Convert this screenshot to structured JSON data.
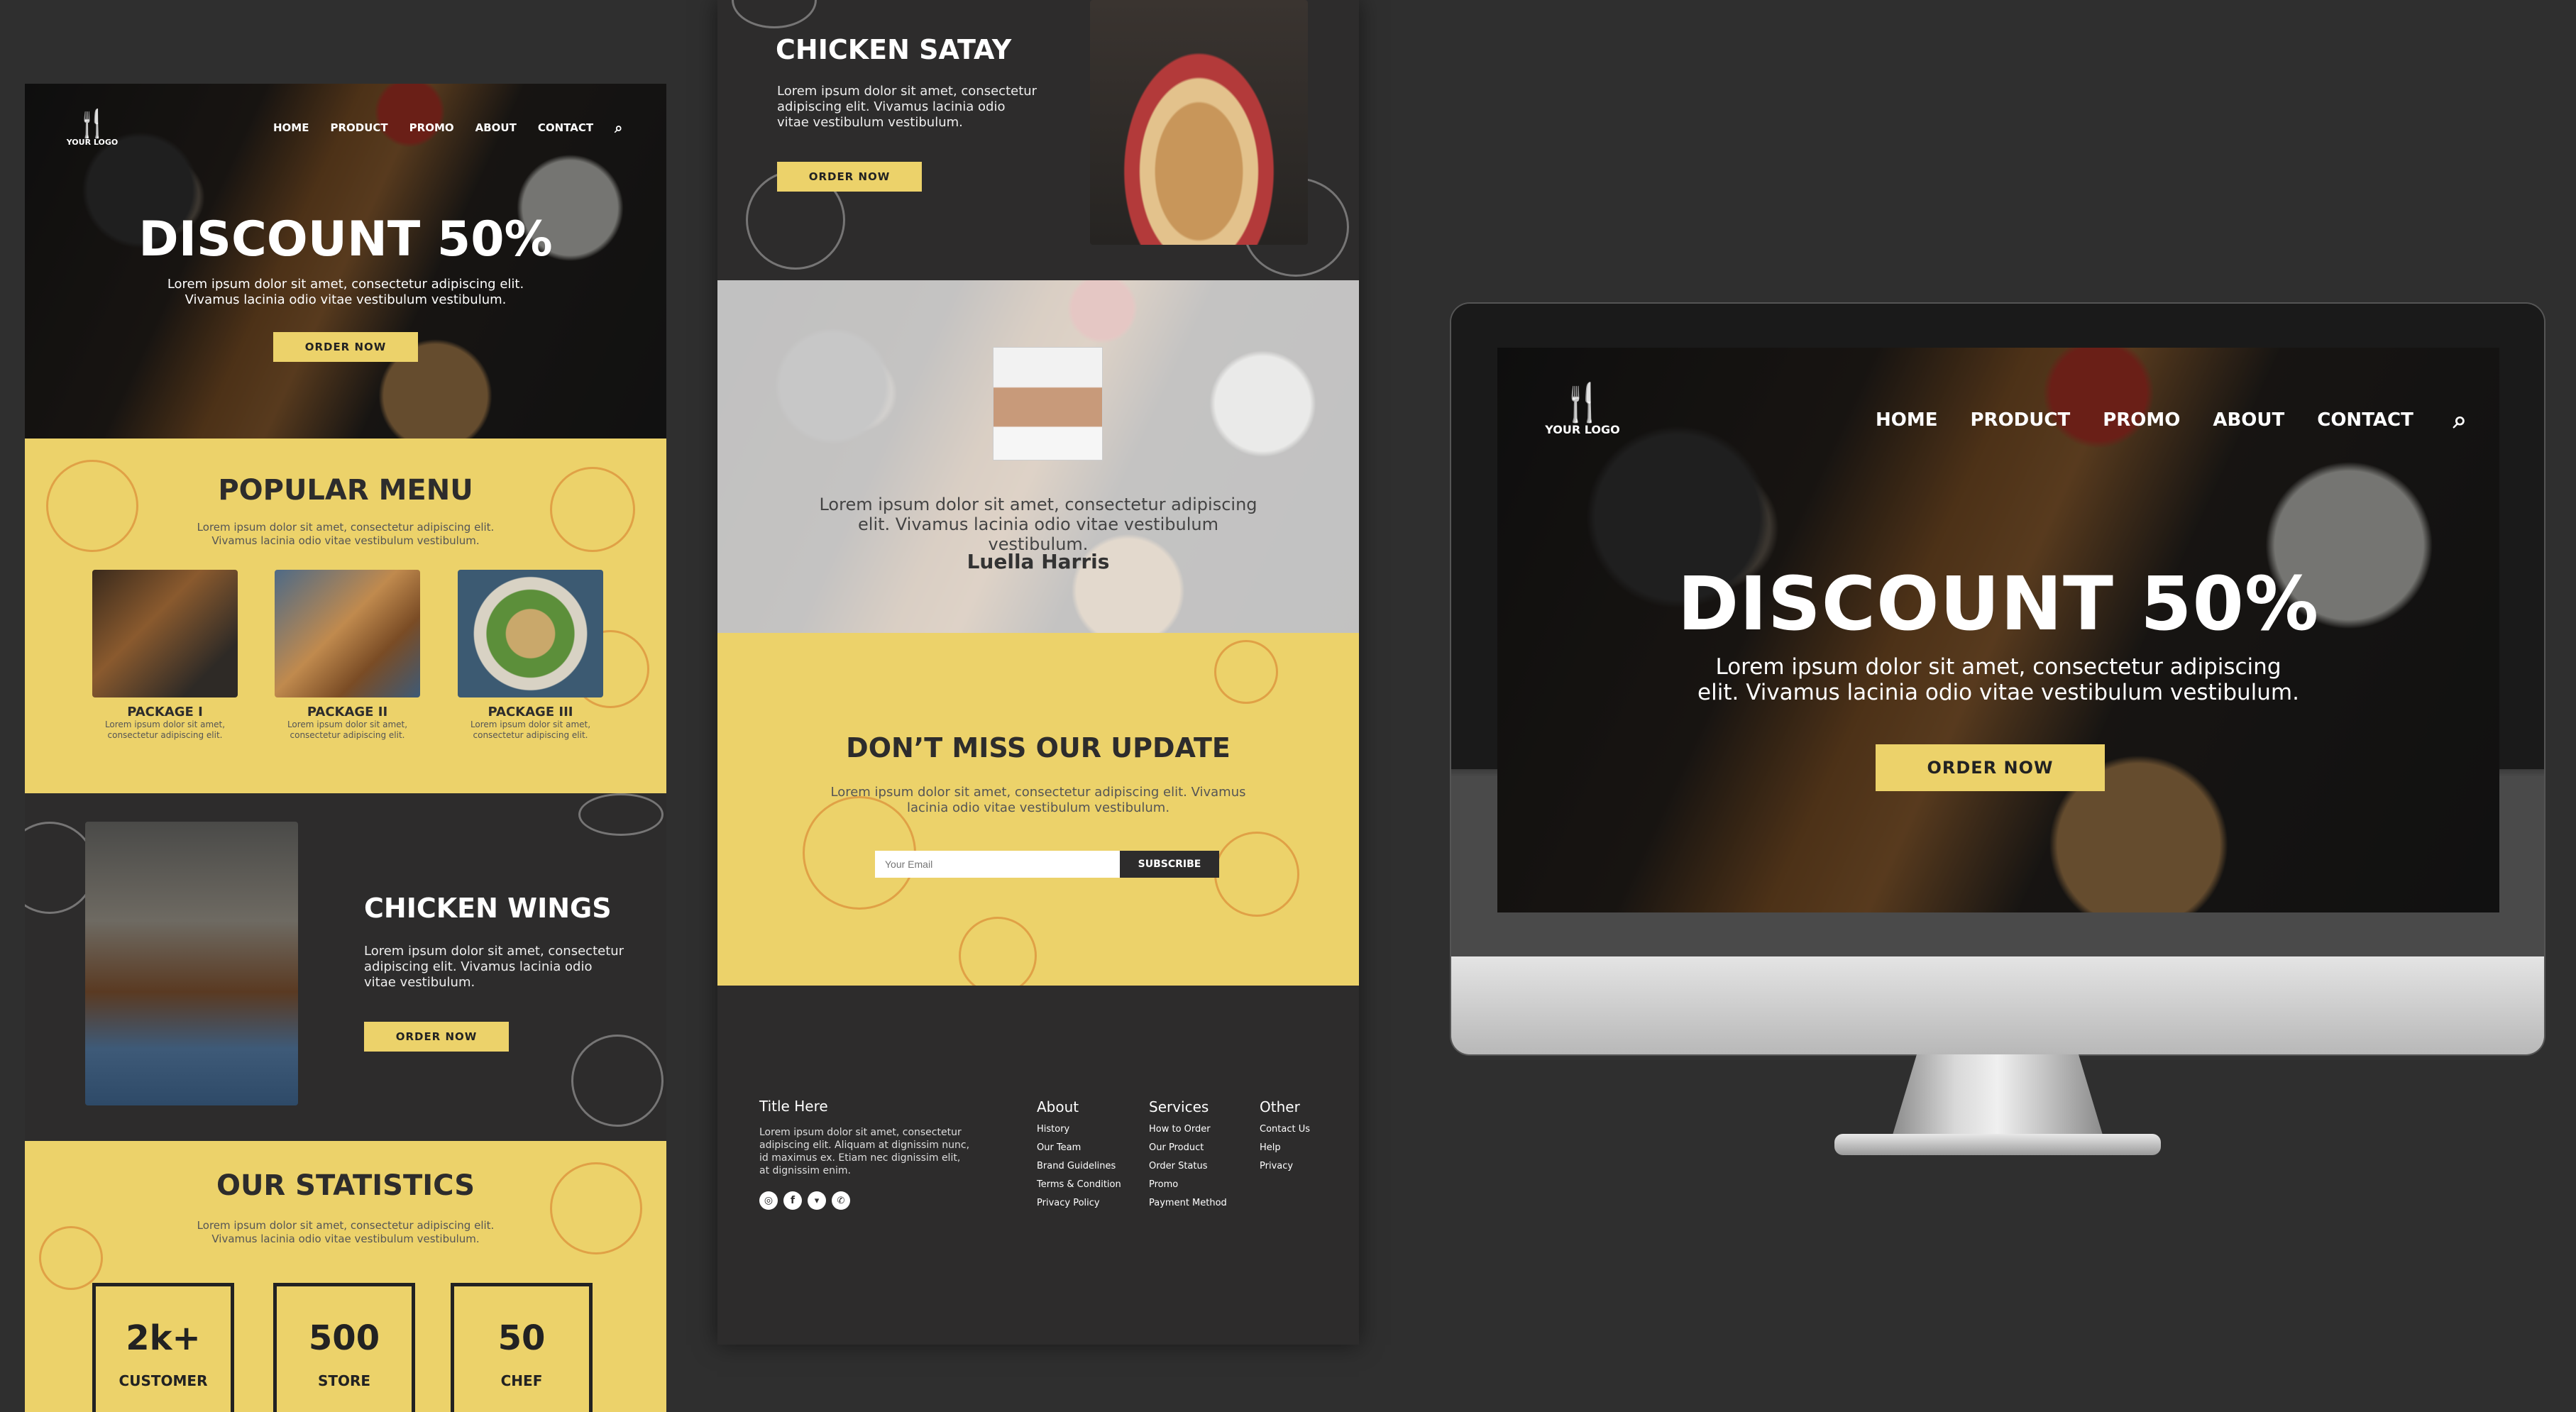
{
  "left_panel": {
    "logo_text": "YOUR LOGO",
    "nav": [
      "HOME",
      "PRODUCT",
      "PROMO",
      "ABOUT",
      "CONTACT"
    ],
    "hero": {
      "title": "DISCOUNT 50%",
      "text": "Lorem ipsum dolor sit amet, consectetur adipiscing elit. Vivamus lacinia odio vitae vestibulum vestibulum.",
      "button": "ORDER NOW"
    },
    "popular_menu": {
      "title": "POPULAR MENU",
      "text": "Lorem ipsum dolor sit amet, consectetur adipiscing elit. Vivamus lacinia odio vitae vestibulum vestibulum.",
      "packages": [
        {
          "name": "PACKAGE I",
          "desc": "Lorem ipsum dolor sit amet, consectetur adipiscing elit."
        },
        {
          "name": "PACKAGE II",
          "desc": "Lorem ipsum dolor sit amet, consectetur adipiscing elit."
        },
        {
          "name": "PACKAGE III",
          "desc": "Lorem ipsum dolor sit amet, consectetur adipiscing elit."
        }
      ]
    },
    "chicken_wings": {
      "title": "CHICKEN WINGS",
      "text": "Lorem ipsum dolor sit amet, consectetur adipiscing elit. Vivamus lacinia odio vitae vestibulum.",
      "button": "ORDER NOW"
    },
    "statistics": {
      "title": "OUR STATISTICS",
      "text": "Lorem ipsum dolor sit amet, consectetur adipiscing elit. Vivamus lacinia odio vitae vestibulum vestibulum.",
      "items": [
        {
          "value": "2k+",
          "label": "CUSTOMER"
        },
        {
          "value": "500",
          "label": "STORE"
        },
        {
          "value": "50",
          "label": "CHEF"
        }
      ]
    }
  },
  "middle_panel": {
    "chicken_satay": {
      "title": "CHICKEN SATAY",
      "text": "Lorem ipsum dolor sit amet, consectetur adipiscing elit. Vivamus lacinia odio vitae vestibulum vestibulum.",
      "button": "ORDER NOW"
    },
    "testimonial": {
      "quote": "Lorem ipsum dolor sit amet, consectetur adipiscing elit. Vivamus lacinia odio vitae vestibulum vestibulum.",
      "name": "Luella Harris"
    },
    "newsletter": {
      "title": "DON’T MISS OUR UPDATE",
      "text": "Lorem ipsum dolor sit amet, consectetur adipiscing elit. Vivamus lacinia odio vitae vestibulum vestibulum.",
      "placeholder": "Your Email",
      "button": "SUBSCRIBE"
    },
    "footer": {
      "title": "Title Here",
      "text": "Lorem ipsum dolor sit amet, consectetur adipiscing elit. Aliquam at dignissim nunc, id maximus ex. Etiam nec dignissim elit, at dignissim enim.",
      "columns": [
        {
          "heading": "About",
          "links": [
            "History",
            "Our Team",
            "Brand Guidelines",
            "Terms & Condition",
            "Privacy Policy"
          ]
        },
        {
          "heading": "Services",
          "links": [
            "How to Order",
            "Our Product",
            "Order Status",
            "Promo",
            "Payment Method"
          ]
        },
        {
          "heading": "Other",
          "links": [
            "Contact Us",
            "Help",
            "Privacy"
          ]
        }
      ],
      "social_icons": [
        "instagram-icon",
        "facebook-icon",
        "twitter-icon",
        "whatsapp-icon"
      ]
    }
  },
  "monitor": {
    "logo_text": "YOUR LOGO",
    "nav": [
      "HOME",
      "PRODUCT",
      "PROMO",
      "ABOUT",
      "CONTACT"
    ],
    "hero": {
      "title": "DISCOUNT 50%",
      "text_line1": "Lorem ipsum dolor sit amet, consectetur adipiscing",
      "text_line2": "elit. Vivamus lacinia odio vitae vestibulum vestibulum.",
      "button": "ORDER NOW"
    }
  },
  "colors": {
    "accent": "#ecd26a",
    "dark": "#2d2c2c",
    "background": "#2f2f2f"
  }
}
